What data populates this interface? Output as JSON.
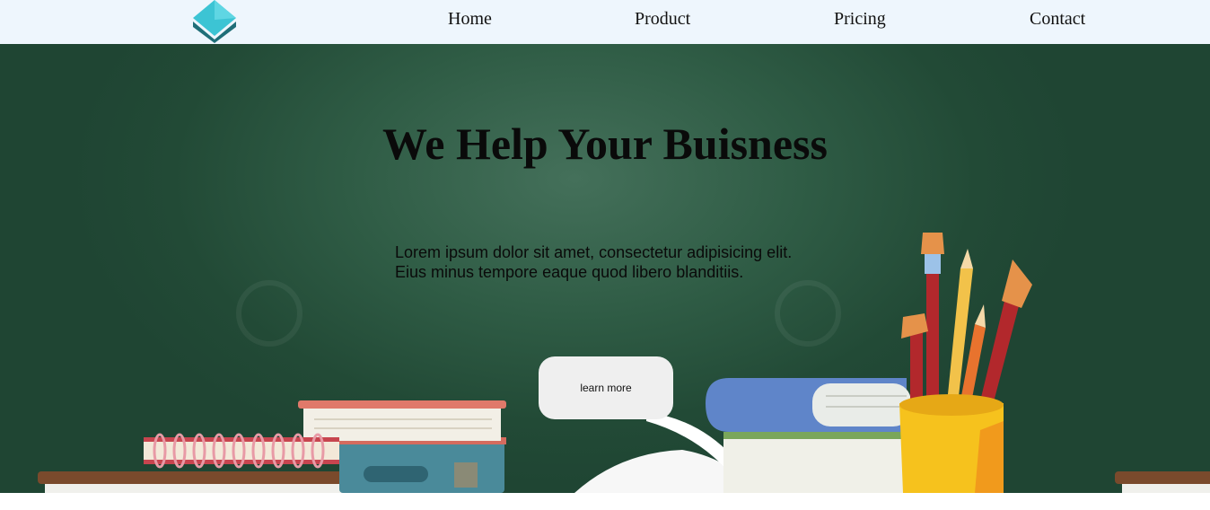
{
  "nav": {
    "items": [
      {
        "label": "Home"
      },
      {
        "label": "Product"
      },
      {
        "label": "Pricing"
      },
      {
        "label": "Contact"
      }
    ]
  },
  "hero": {
    "title": "We Help Your Buisness",
    "text_line1": "Lorem ipsum dolor sit amet, consectetur adipisicing elit.",
    "text_line2": "Eius minus tempore eaque quod libero blanditiis.",
    "button_label": "learn more"
  },
  "colors": {
    "nav_bg": "#eef6fd",
    "hero_bg": "#2f5c45",
    "logo_teal": "#3cc4d4",
    "button_bg": "#efefef"
  }
}
